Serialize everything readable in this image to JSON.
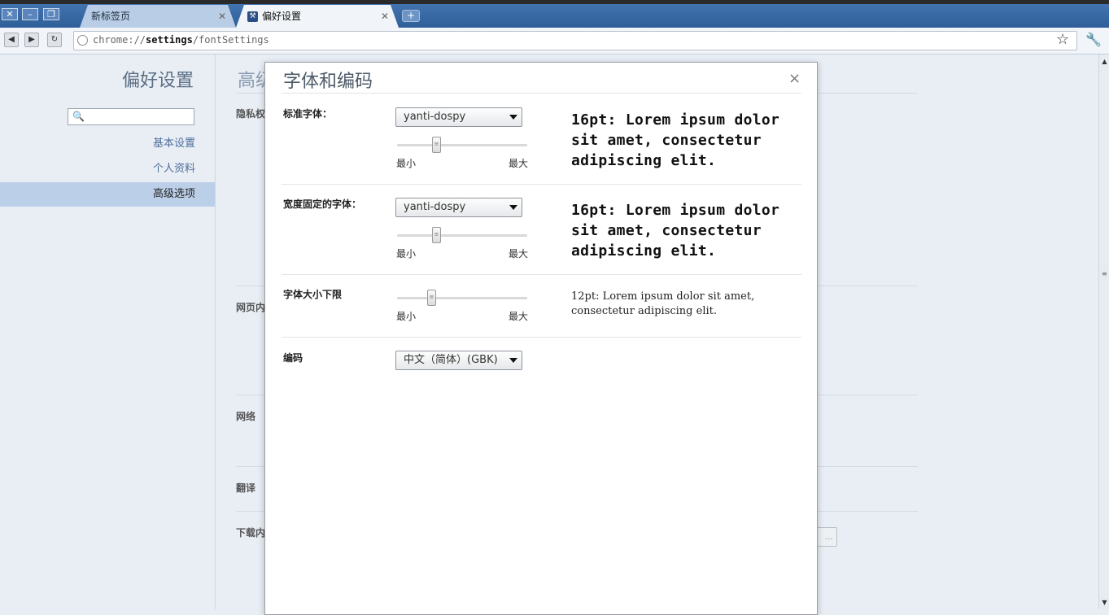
{
  "window": {
    "tabs": [
      {
        "label": "新标签页",
        "active": false
      },
      {
        "label": "偏好设置",
        "active": true
      }
    ],
    "url_prefix": "chrome://",
    "url_bold": "settings",
    "url_suffix": "/fontSettings"
  },
  "sidebar": {
    "title": "偏好设置",
    "items": [
      {
        "label": "基本设置"
      },
      {
        "label": "个人资料"
      },
      {
        "label": "高级选项",
        "selected": true
      }
    ]
  },
  "background": {
    "heading_partial": "高级",
    "sections": [
      "隐私权",
      "网页内",
      "网络",
      "翻译",
      "下载内"
    ],
    "button_partial": "..."
  },
  "dialog": {
    "title": "字体和编码",
    "close": "×",
    "standard_font": {
      "label": "标准字体：",
      "value": "yanti-dospy",
      "slider_min": "最小",
      "slider_max": "最大",
      "preview": "16pt: Lorem ipsum dolor sit amet, consectetur adipiscing elit."
    },
    "fixed_font": {
      "label": "宽度固定的字体：",
      "value": "yanti-dospy",
      "slider_min": "最小",
      "slider_max": "最大",
      "preview": "16pt: Lorem ipsum dolor sit amet, consectetur adipiscing elit."
    },
    "min_size": {
      "label": "字体大小下限",
      "slider_min": "最小",
      "slider_max": "最大",
      "preview": "12pt: Lorem ipsum dolor sit amet, consectetur adipiscing elit."
    },
    "encoding": {
      "label": "编码",
      "value": "中文（简体）(GBK)"
    }
  },
  "colors": {
    "titlebar": "#3a6ea5",
    "selected_nav": "#bccfe8",
    "link": "#4f6f9b"
  }
}
